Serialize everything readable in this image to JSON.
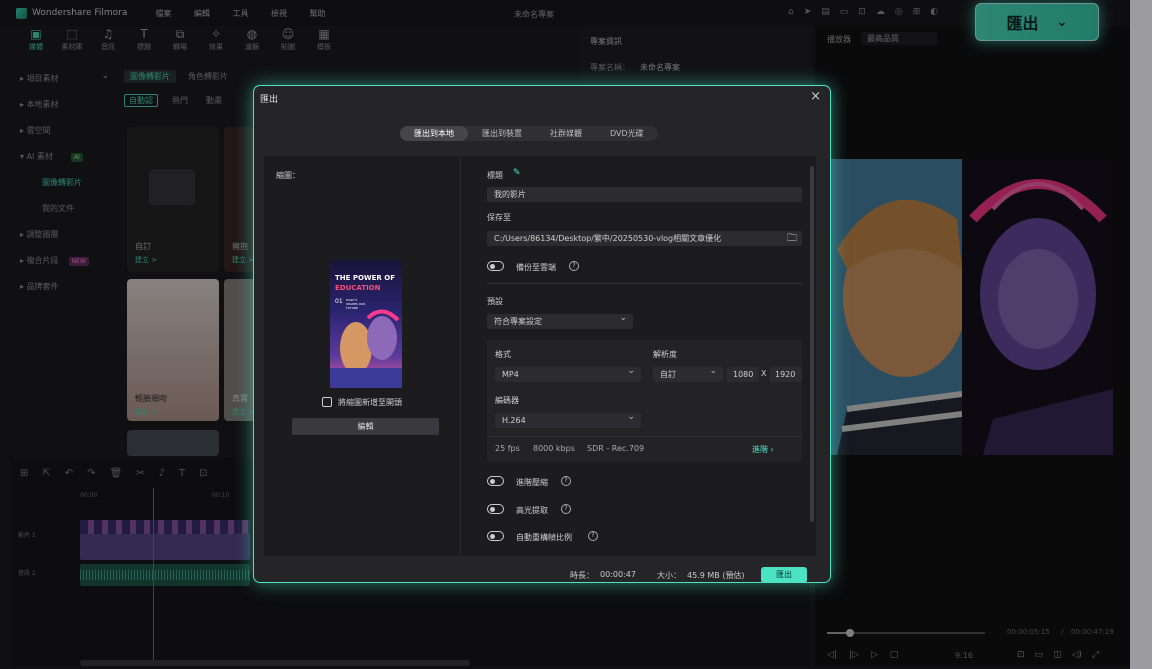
{
  "app": {
    "brand": "Wondershare Filmora",
    "menu": [
      "檔案",
      "編輯",
      "工具",
      "檢視",
      "幫助"
    ],
    "window_title": "未命名專案"
  },
  "toolbar": [
    "媒體",
    "素材庫",
    "音訊",
    "標題",
    "轉場",
    "效果",
    "濾鏡",
    "貼圖",
    "模板"
  ],
  "left_nav": [
    "項目素材",
    "本地素材",
    "雲空間",
    "AI 素材",
    "圖像轉影片",
    "我的文件",
    "調整圖層",
    "複合片段",
    "品牌套件"
  ],
  "left_nav_badges": {
    "ai": "AI",
    "compound": "NEW"
  },
  "media_tabs": [
    "圖像轉影片",
    "角色轉影片"
  ],
  "media_subtabs": [
    "自動認",
    "熱門",
    "動畫"
  ],
  "media_cards": [
    {
      "title": "自訂",
      "action": "建立 >"
    },
    {
      "title": "擁抱",
      "action": "建立 >"
    },
    {
      "title": "輕臉頰吻",
      "action": "建立 >"
    },
    {
      "title": "真實",
      "action": "建立 >"
    }
  ],
  "props": {
    "tab": "專案資訊",
    "name_label": "專案名稱：",
    "name_value": "未命名專案"
  },
  "preview_header": {
    "label": "播放器",
    "quality": "最高品質"
  },
  "preview_footer": {
    "current": "00:00:05:15",
    "sep": "/",
    "total": "00:00:47:19",
    "ratio": "9:16"
  },
  "timeline": {
    "ruler": [
      "00:00",
      "00:10"
    ],
    "tracks": [
      "影片 1",
      "音訊 1"
    ]
  },
  "export_button": {
    "label": "匯出"
  },
  "dialog": {
    "title": "匯出",
    "tabs": [
      "匯出到本地",
      "匯出到裝置",
      "社群媒體",
      "DVD光碟"
    ],
    "thumbnail_label": "縮圖：",
    "thumb_text": {
      "line1": "THE POWER OF",
      "line2": "EDUCATION",
      "line3": "01",
      "line4": "HOW IT SHAPES OUR FUTURE"
    },
    "add_thumb_label": "將縮圖新增至開頭",
    "edit_button": "編輯",
    "title_label": "標題",
    "title_value": "我的影片",
    "save_label": "保存至",
    "save_path": "C:/Users/86134/Desktop/繁中/20250530-vlog相關文章優化",
    "backup_label": "備份至雲端",
    "preset_label": "預設",
    "preset_value": "符合專案設定",
    "format_label": "格式",
    "format_value": "MP4",
    "resolution_label": "解析度",
    "resolution_mode": "自訂",
    "res_w": "1080",
    "res_x": "X",
    "res_h": "1920",
    "encoder_label": "編碼器",
    "encoder_value": "H.264",
    "fps": "25 fps",
    "bitrate": "8000 kbps",
    "color": "SDR - Rec.709",
    "advanced": "進階",
    "opt1": "進階壓縮",
    "opt2": "高光提取",
    "opt3": "自動重構幀比例",
    "duration_label": "時長：",
    "duration_value": "00:00:47",
    "size_label": "大小：",
    "size_value": "45.9 MB (預估)",
    "export_btn": "匯出"
  }
}
